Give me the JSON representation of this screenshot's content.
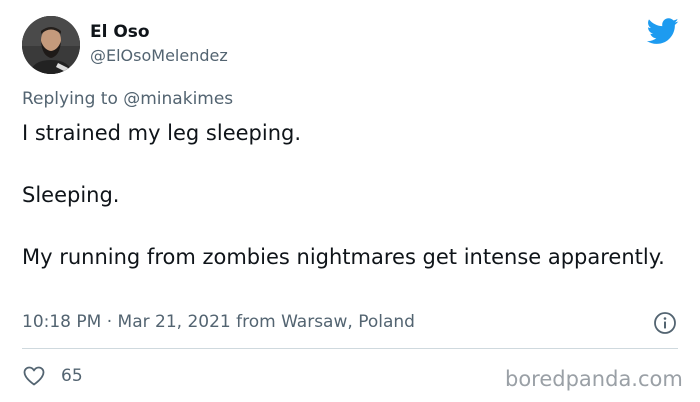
{
  "user": {
    "display_name": "El Oso",
    "handle": "@ElOsoMelendez",
    "avatar_icon": "user-avatar"
  },
  "brand": {
    "icon": "twitter-bird-icon",
    "accent": "#1d9bf0"
  },
  "reply": {
    "prefix": "Replying to",
    "mention": "@minakimes"
  },
  "tweet": {
    "lines": [
      "I strained my leg sleeping.",
      "Sleeping.",
      "My running from zombies nightmares get intense apparently."
    ]
  },
  "meta": {
    "text": "10:18 PM · Mar 21, 2021 from Warsaw, Poland",
    "info_icon": "info-icon"
  },
  "actions": {
    "like_icon": "heart-icon",
    "like_count": "65"
  },
  "watermark": "boredpanda.com",
  "colors": {
    "text": "#0f1419",
    "muted": "#536471",
    "divider": "#cfd9de"
  }
}
